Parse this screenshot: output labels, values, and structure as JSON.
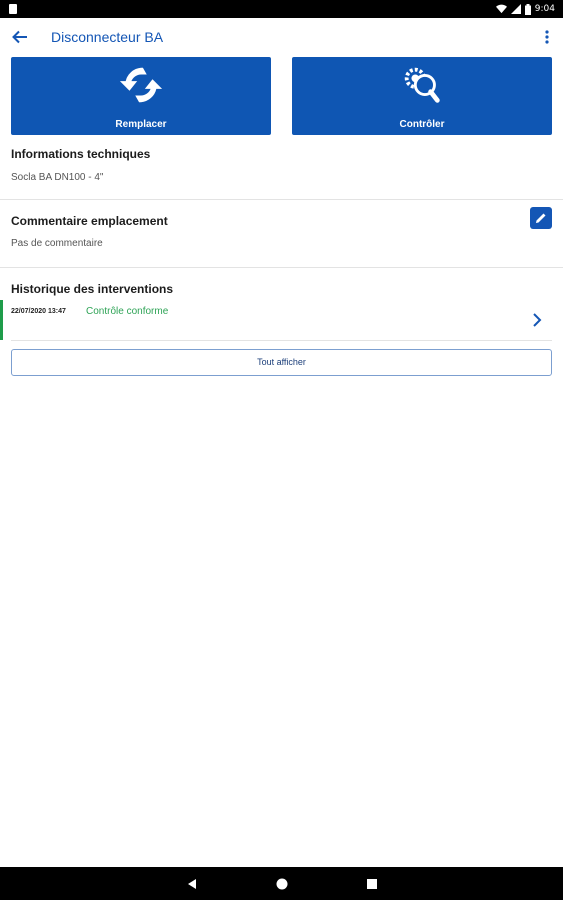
{
  "status_bar": {
    "time": "9:04"
  },
  "app_bar": {
    "title": "Disconnecteur BA"
  },
  "actions": {
    "replace_label": "Remplacer",
    "control_label": "Contrôler"
  },
  "tech_info": {
    "title": "Informations techniques",
    "text": "Socla BA DN100 - 4\""
  },
  "location_comment": {
    "title": "Commentaire emplacement",
    "text": "Pas de commentaire"
  },
  "history": {
    "title": "Historique des interventions",
    "items": [
      {
        "date": "22/07/2020 13:47",
        "status": "Contrôle conforme"
      }
    ],
    "show_all_label": "Tout afficher"
  },
  "colors": {
    "primary": "#0f56b3",
    "success": "#2ea356",
    "title_blue": "#1456b5"
  }
}
